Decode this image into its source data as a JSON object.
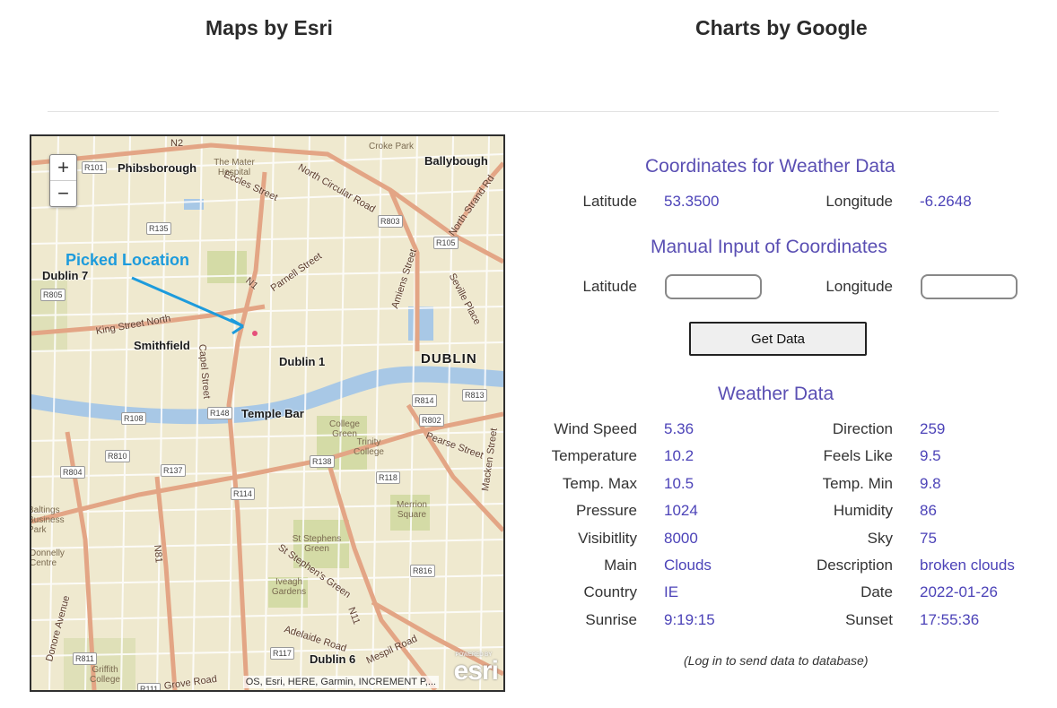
{
  "header": {
    "maps_title": "Maps by Esri",
    "charts_title": "Charts by Google"
  },
  "map": {
    "zoom_in": "+",
    "zoom_out": "−",
    "picked_label": "Picked Location",
    "attribution": "OS, Esri, HERE, Garmin, INCREMENT P,...",
    "logo_text": "esri",
    "logo_small": "POWERED BY",
    "places": [
      "Phibsborough",
      "Ballybough",
      "Dublin 7",
      "Smithfield",
      "Dublin 1",
      "DUBLIN",
      "Temple Bar",
      "Dublin 6"
    ],
    "streets": [
      "Eccles Street",
      "North Circular Road",
      "Parnell Street",
      "King Street North",
      "Capel Street",
      "Amiens Street",
      "Seville Place",
      "North Strand Rd",
      "Pearse Street",
      "St Stephen's Green",
      "Adelaide Road",
      "Mespil Road",
      "Grove Road",
      "N1",
      "N81",
      "N11",
      "N2",
      "Donore Avenue",
      "Macken Street"
    ],
    "pois": [
      "Croke Park",
      "The Mater Hospital",
      "College Green",
      "Trinity College",
      "St Stephens Green",
      "Iveagh Gardens",
      "Merrion Square",
      "Griffith College",
      "Baltings Business Park",
      "Donnelly Centre"
    ],
    "shields": [
      "R101",
      "R135",
      "R805",
      "R803",
      "R105",
      "R108",
      "R148",
      "R814",
      "R813",
      "R802",
      "R810",
      "R137",
      "R138",
      "R804",
      "R118",
      "R114",
      "R816",
      "R117",
      "R811",
      "R111"
    ],
    "colors": {
      "land": "#efe9cf",
      "road": "#e3a585",
      "water": "#a8c8e6",
      "park": "#d4dba6",
      "arrow": "#1d9bdc",
      "pin": "#e5507b"
    }
  },
  "coords": {
    "title": "Coordinates for Weather Data",
    "lat_label": "Latitude",
    "lat_value": "53.3500",
    "lon_label": "Longitude",
    "lon_value": "-6.2648"
  },
  "manual": {
    "title": "Manual Input of Coordinates",
    "lat_label": "Latitude",
    "lat_value": "",
    "lon_label": "Longitude",
    "lon_value": "",
    "button_label": "Get Data"
  },
  "weather": {
    "title": "Weather Data",
    "left": [
      {
        "label": "Wind Speed",
        "value": "5.36"
      },
      {
        "label": "Temperature",
        "value": "10.2"
      },
      {
        "label": "Temp. Max",
        "value": "10.5"
      },
      {
        "label": "Pressure",
        "value": "1024"
      },
      {
        "label": "Visibitlity",
        "value": "8000"
      },
      {
        "label": "Main",
        "value": "Clouds"
      },
      {
        "label": "Country",
        "value": "IE"
      },
      {
        "label": "Sunrise",
        "value": "9:19:15"
      }
    ],
    "right": [
      {
        "label": "Direction",
        "value": "259"
      },
      {
        "label": "Feels Like",
        "value": "9.5"
      },
      {
        "label": "Temp. Min",
        "value": "9.8"
      },
      {
        "label": "Humidity",
        "value": "86"
      },
      {
        "label": "Sky",
        "value": "75"
      },
      {
        "label": "Description",
        "value": "broken clouds"
      },
      {
        "label": "Date",
        "value": "2022-01-26"
      },
      {
        "label": "Sunset",
        "value": "17:55:36"
      }
    ]
  },
  "note": "(Log in to send data to database)"
}
